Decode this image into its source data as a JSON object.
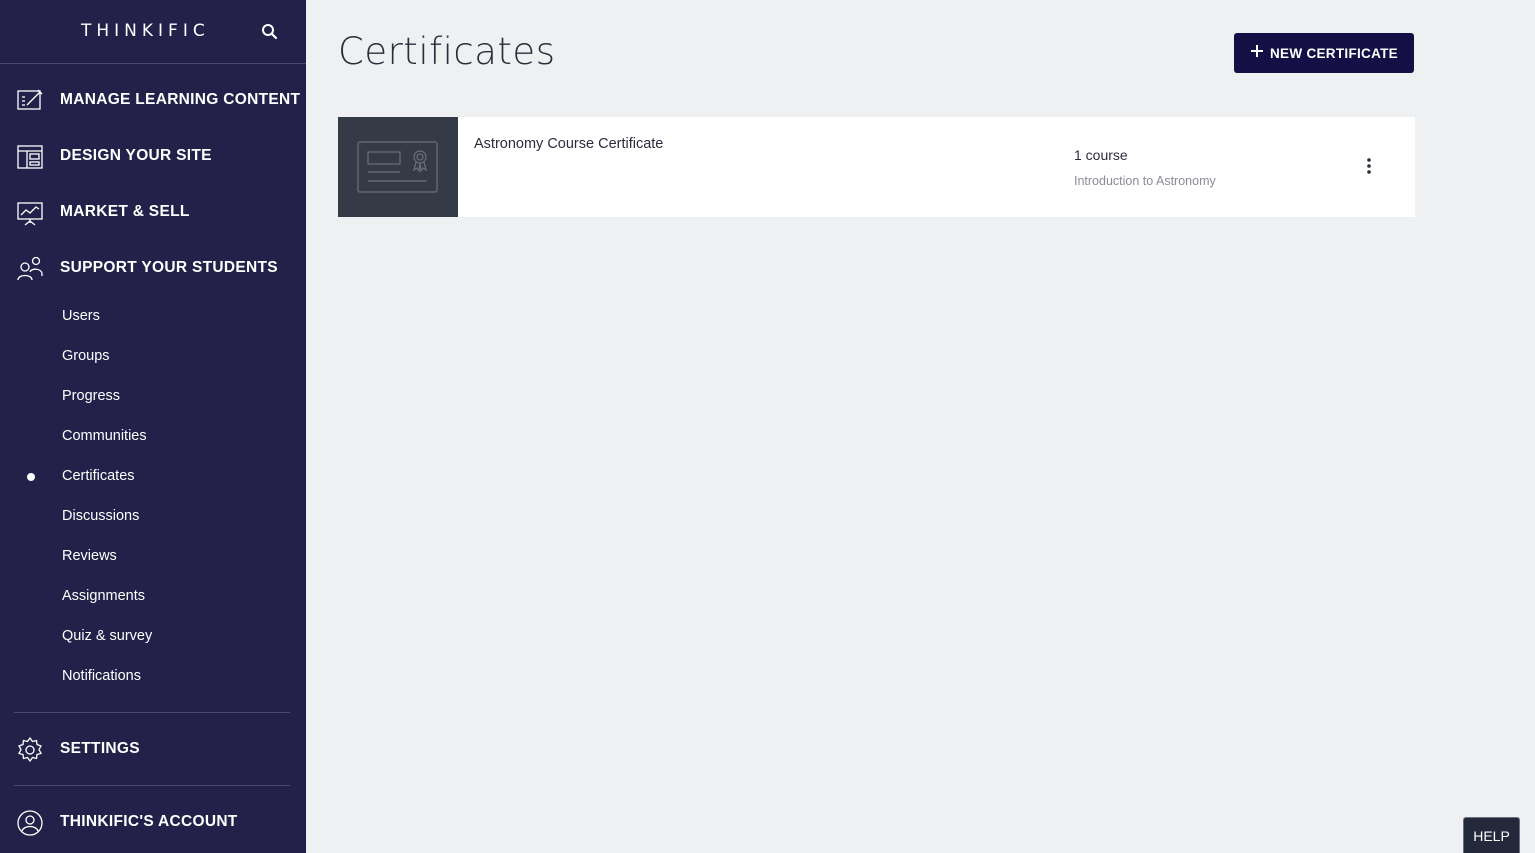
{
  "brand": {
    "logo_text": "THINKIFIC"
  },
  "icons": {
    "search": "search-icon",
    "manage": "edit-document-icon",
    "design": "layout-icon",
    "market": "chart-presentation-icon",
    "support": "users-icon",
    "settings": "gear-icon",
    "account": "user-circle-icon",
    "kebab": "more-vertical-icon",
    "plus": "plus-icon"
  },
  "colors": {
    "sidebar_bg": "#23214a",
    "primary_button": "#140f44",
    "page_bg": "#eff0f2"
  },
  "sidebar": {
    "sections": [
      {
        "label": "MANAGE LEARNING CONTENT"
      },
      {
        "label": "DESIGN YOUR SITE"
      },
      {
        "label": "MARKET & SELL"
      },
      {
        "label": "SUPPORT YOUR STUDENTS"
      }
    ],
    "support_items": [
      {
        "label": "Users"
      },
      {
        "label": "Groups"
      },
      {
        "label": "Progress"
      },
      {
        "label": "Communities"
      },
      {
        "label": "Certificates",
        "active": true
      },
      {
        "label": "Discussions"
      },
      {
        "label": "Reviews"
      },
      {
        "label": "Assignments"
      },
      {
        "label": "Quiz & survey"
      },
      {
        "label": "Notifications"
      }
    ],
    "settings_label": "SETTINGS",
    "account_label": "THINKIFIC'S ACCOUNT"
  },
  "main": {
    "title": "Certificates",
    "new_button_label": "NEW CERTIFICATE",
    "certificates": [
      {
        "name": "Astronomy Course Certificate",
        "course_count": "1 course",
        "course_name": "Introduction to Astronomy"
      }
    ]
  },
  "help_label": "HELP"
}
